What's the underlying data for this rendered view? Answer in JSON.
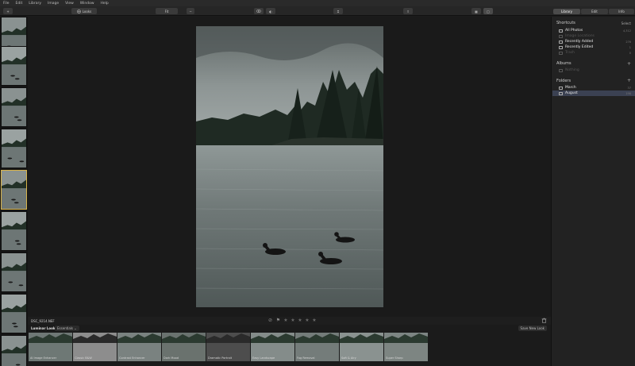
{
  "menubar": [
    "File",
    "Edit",
    "Library",
    "Image",
    "View",
    "Window",
    "Help"
  ],
  "toolbar": {
    "add_label": "+",
    "looks_label": "Looks",
    "zoom_label": "Fit",
    "zoom_minus": "−",
    "zoom_plus": "+",
    "view_single": "▢",
    "view_grid": "▦",
    "compare_label": "◐",
    "share_label": "⇪",
    "crop_label": "⌗"
  },
  "right_tabs": [
    {
      "label": "Library",
      "active": true
    },
    {
      "label": "Edit",
      "active": false
    },
    {
      "label": "Info",
      "active": false
    }
  ],
  "shortcuts": {
    "title": "Shortcuts",
    "action": "Select",
    "items": [
      {
        "label": "All Photos",
        "count": "4,312",
        "dim": false
      },
      {
        "label": "Image Locations",
        "count": "",
        "dim": true
      },
      {
        "label": "Recently Added",
        "count": "276",
        "dim": false
      },
      {
        "label": "Recently Edited",
        "count": "1",
        "dim": false
      },
      {
        "label": "Trash",
        "count": "0",
        "dim": true
      }
    ]
  },
  "albums": {
    "title": "Albums",
    "add": "+",
    "items": [
      {
        "label": "Nothing",
        "dim": true
      }
    ]
  },
  "folders": {
    "title": "Folders",
    "add": "+",
    "items": [
      {
        "label": "March",
        "count": "37",
        "selected": false
      },
      {
        "label": "August",
        "count": "198",
        "selected": true
      }
    ]
  },
  "info": {
    "file": "DSC_9214.NEF"
  },
  "rating": {
    "stars": 5,
    "filled": 0
  },
  "looks": {
    "tab": "Luminar Looks",
    "dropdown": "Essentials ⌄",
    "save": "Save New Look",
    "items": [
      "AI Image Enhancer",
      "Classic B&W",
      "Contrast Enhancer",
      "Dark Mood",
      "Dramatic Portrait",
      "Easy Landscape",
      "Fog Removal",
      "Soft & Airy",
      "Super Sharp"
    ]
  },
  "colors": {
    "accent": "#d9b44a",
    "selected_row": "#3b4152"
  }
}
